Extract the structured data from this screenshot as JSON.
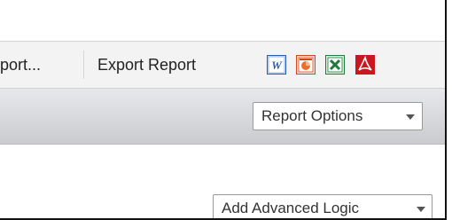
{
  "toolbar": {
    "truncated_label": "port...",
    "export_label": "Export Report",
    "icons": [
      "word-icon",
      "powerpoint-icon",
      "excel-icon",
      "pdf-icon"
    ]
  },
  "band": {
    "report_options_label": "Report Options"
  },
  "content": {
    "add_logic_label": "Add Advanced Logic"
  },
  "colors": {
    "word": "#2b5fb6",
    "powerpoint": "#d2461f",
    "excel": "#1e7b3c",
    "pdf": "#c8171e"
  }
}
